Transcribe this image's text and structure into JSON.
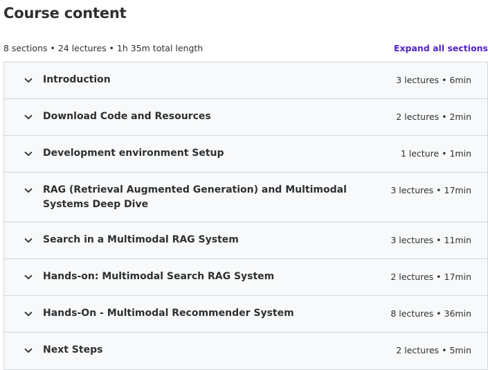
{
  "header": {
    "title": "Course content",
    "summary": "8 sections • 24 lectures • 1h 35m total length",
    "expand_all_label": "Expand all sections"
  },
  "sections": [
    {
      "title": "Introduction",
      "meta": "3 lectures • 6min"
    },
    {
      "title": "Download Code and Resources",
      "meta": "2 lectures • 2min"
    },
    {
      "title": "Development environment Setup",
      "meta": "1 lecture • 1min"
    },
    {
      "title": "RAG (Retrieval Augmented Generation) and Multimodal Systems Deep Dive",
      "meta": "3 lectures • 17min"
    },
    {
      "title": "Search in a Multimodal RAG System",
      "meta": "3 lectures • 11min"
    },
    {
      "title": "Hands-on: Multimodal Search RAG System",
      "meta": "2 lectures • 17min"
    },
    {
      "title": "Hands-On - Multimodal Recommender System",
      "meta": "8 lectures • 36min"
    },
    {
      "title": "Next Steps",
      "meta": "2 lectures • 5min"
    }
  ],
  "icons": {
    "section_toggle": "chevron-down-icon"
  },
  "colors": {
    "text": "#2d2f31",
    "link": "#5022c3",
    "section_bg": "#f7f9fa",
    "border": "#d1d7dc"
  }
}
